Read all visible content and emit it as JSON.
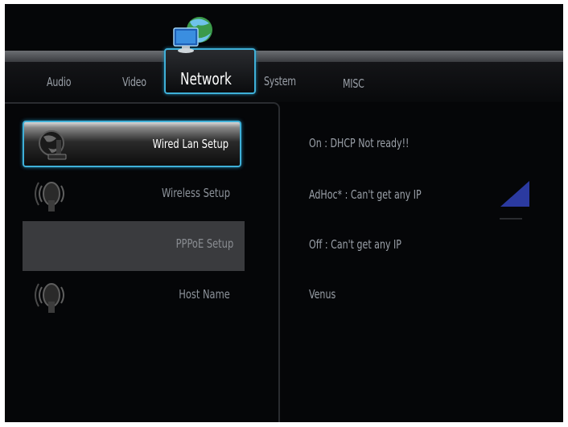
{
  "tabs": [
    {
      "label": "Audio"
    },
    {
      "label": "Video"
    },
    {
      "label": "Network",
      "selected": true
    },
    {
      "label": "System"
    },
    {
      "label": "MISC"
    }
  ],
  "menu": {
    "items": [
      {
        "label": "Wired Lan Setup",
        "value": "On : DHCP Not ready!!",
        "icon": "wired-lan-icon",
        "selected": true
      },
      {
        "label": "Wireless Setup",
        "value": "AdHoc* : Can't get any IP",
        "icon": "wireless-antenna-icon"
      },
      {
        "label": "PPPoE Setup",
        "value": "Off : Can't get any IP",
        "icon": "none"
      },
      {
        "label": "Host Name",
        "value": "Venus",
        "icon": "wireless-antenna-icon"
      }
    ]
  },
  "colors": {
    "accent": "#3fb0d8",
    "background": "#050608",
    "signal": "#2b3aa0"
  },
  "indicators": {
    "signal_icon": "signal-strength-icon"
  }
}
